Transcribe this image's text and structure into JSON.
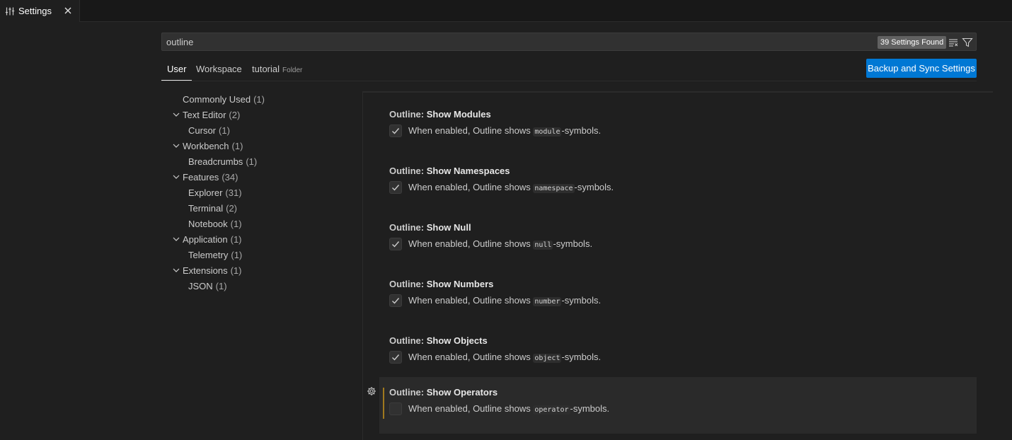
{
  "tab": {
    "label": "Settings"
  },
  "search": {
    "value": "outline",
    "count_label": "39 Settings Found"
  },
  "scopes": [
    {
      "label": "User"
    },
    {
      "label": "Workspace"
    },
    {
      "label": "tutorial",
      "hint": "Folder"
    }
  ],
  "sync_button": "Backup and Sync Settings",
  "toc": [
    {
      "label": "Commonly Used",
      "count": "(1)"
    },
    {
      "label": "Text Editor",
      "count": "(2)"
    },
    {
      "label": "Cursor",
      "count": "(1)"
    },
    {
      "label": "Workbench",
      "count": "(1)"
    },
    {
      "label": "Breadcrumbs",
      "count": "(1)"
    },
    {
      "label": "Features",
      "count": "(34)"
    },
    {
      "label": "Explorer",
      "count": "(31)"
    },
    {
      "label": "Terminal",
      "count": "(2)"
    },
    {
      "label": "Notebook",
      "count": "(1)"
    },
    {
      "label": "Application",
      "count": "(1)"
    },
    {
      "label": "Telemetry",
      "count": "(1)"
    },
    {
      "label": "Extensions",
      "count": "(1)"
    },
    {
      "label": "JSON",
      "count": "(1)"
    }
  ],
  "settings": [
    {
      "category": "Outline:",
      "name": "Show Modules",
      "desc_prefix": "When enabled, Outline shows",
      "code": "module",
      "desc_suffix": "-symbols.",
      "checked": true
    },
    {
      "category": "Outline:",
      "name": "Show Namespaces",
      "desc_prefix": "When enabled, Outline shows",
      "code": "namespace",
      "desc_suffix": "-symbols.",
      "checked": true
    },
    {
      "category": "Outline:",
      "name": "Show Null",
      "desc_prefix": "When enabled, Outline shows",
      "code": "null",
      "desc_suffix": "-symbols.",
      "checked": true
    },
    {
      "category": "Outline:",
      "name": "Show Numbers",
      "desc_prefix": "When enabled, Outline shows",
      "code": "number",
      "desc_suffix": "-symbols.",
      "checked": true
    },
    {
      "category": "Outline:",
      "name": "Show Objects",
      "desc_prefix": "When enabled, Outline shows",
      "code": "object",
      "desc_suffix": "-symbols.",
      "checked": true
    },
    {
      "category": "Outline:",
      "name": "Show Operators",
      "desc_prefix": "When enabled, Outline shows",
      "code": "operator",
      "desc_suffix": "-symbols.",
      "checked": false
    }
  ],
  "colors": {
    "accent": "#0078d4",
    "modified_bar": "#a0791e",
    "background": "#1f1f1f"
  }
}
